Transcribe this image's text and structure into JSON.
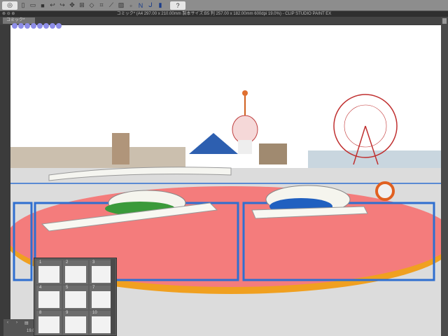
{
  "toolbar": {
    "icons": [
      "app-menu-icon",
      "new-icon",
      "open-icon",
      "save-icon",
      "undo-icon",
      "redo-icon",
      "transform-icon",
      "select-icon",
      "fill-icon",
      "crop-icon",
      "line-icon",
      "tone-icon",
      "blank-icon",
      "ruler-snap-icon",
      "special-ruler-icon",
      "grid-snap-icon",
      "help-icon"
    ]
  },
  "window": {
    "title": "コミック* (A4 297.00 x 210.00mm 製本サイズ:B5 判 257.00 x 182.00mm 600dpi 19.0%)  - CLIP STUDIO PAINT EX"
  },
  "tab": {
    "label": "コミック*"
  },
  "navigator": {
    "zoom": "19.0"
  },
  "pages": [
    {
      "n": "1"
    },
    {
      "n": "2"
    },
    {
      "n": "3"
    },
    {
      "n": "4"
    },
    {
      "n": "5"
    },
    {
      "n": "7"
    },
    {
      "n": "8"
    },
    {
      "n": "9"
    },
    {
      "n": "10"
    }
  ],
  "colors": {
    "platform": "#f47c7c",
    "rail": "#2f6fd0",
    "rim": "#f0a020"
  }
}
